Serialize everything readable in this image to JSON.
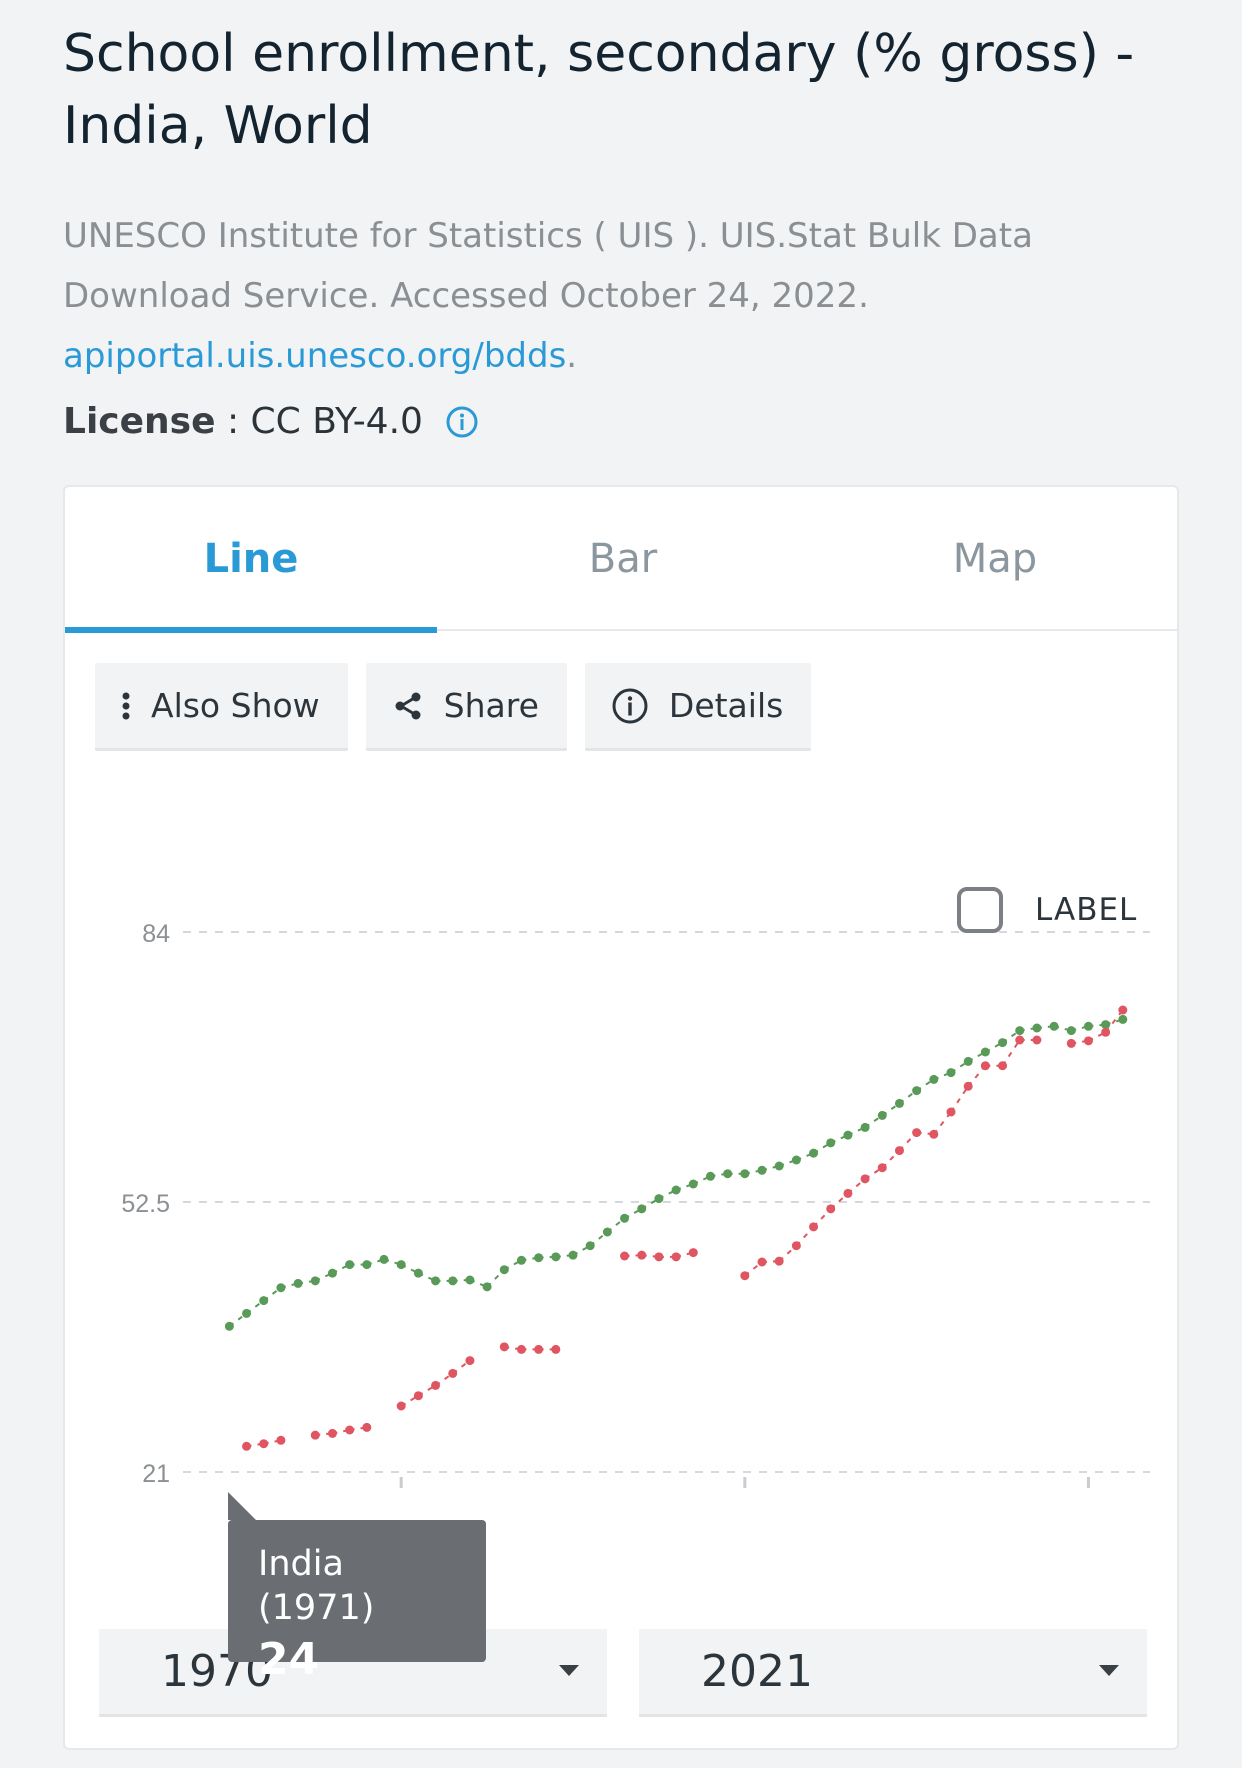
{
  "header": {
    "title": "School enrollment, secondary (% gross) - India, World",
    "source_text": "UNESCO Institute for Statistics ( UIS ). UIS.Stat Bulk Data Download Service. Accessed October 24, 2022.",
    "source_link": "apiportal.uis.unesco.org/bdds",
    "source_link_suffix": ".",
    "license_label": "License",
    "license_sep": " : ",
    "license_value": "CC BY-4.0"
  },
  "tabs": [
    {
      "label": "Line",
      "active": true
    },
    {
      "label": "Bar",
      "active": false
    },
    {
      "label": "Map",
      "active": false
    }
  ],
  "toolbar": {
    "also_show": "Also Show",
    "share": "Share",
    "details": "Details"
  },
  "label_toggle": "LABEL",
  "tooltip": {
    "title": "India (1971)",
    "value": "24"
  },
  "range": {
    "start": "1970",
    "end": "2021"
  },
  "colors": {
    "accent": "#2a9ad7",
    "world": "#5a9a58",
    "india": "#e05562"
  },
  "chart_data": {
    "type": "line",
    "yticks": [
      21,
      52.5,
      84
    ],
    "ytick_labels": [
      "21",
      "52.5",
      "84"
    ],
    "ylim": [
      21,
      84
    ],
    "xlim": [
      1970,
      2021
    ],
    "xticks": [
      1980,
      2000,
      2020
    ],
    "grid": true,
    "series": [
      {
        "key": "world",
        "color": "#5a9a58",
        "points": [
          [
            1970,
            38
          ],
          [
            1971,
            39.5
          ],
          [
            1972,
            41
          ],
          [
            1973,
            42.5
          ],
          [
            1974,
            43
          ],
          [
            1975,
            43.3
          ],
          [
            1976,
            44.2
          ],
          [
            1977,
            45.2
          ],
          [
            1978,
            45.2
          ],
          [
            1979,
            45.8
          ],
          [
            1980,
            45.2
          ],
          [
            1981,
            44.2
          ],
          [
            1982,
            43.3
          ],
          [
            1983,
            43.3
          ],
          [
            1984,
            43.4
          ],
          [
            1985,
            42.6
          ],
          [
            1986,
            44.6
          ],
          [
            1987,
            45.7
          ],
          [
            1988,
            46
          ],
          [
            1989,
            46.1
          ],
          [
            1990,
            46.3
          ],
          [
            1991,
            47.4
          ],
          [
            1992,
            49
          ],
          [
            1993,
            50.6
          ],
          [
            1994,
            51.7
          ],
          [
            1995,
            52.9
          ],
          [
            1996,
            53.9
          ],
          [
            1997,
            54.6
          ],
          [
            1998,
            55.5
          ],
          [
            1999,
            55.8
          ],
          [
            2000,
            55.8
          ],
          [
            2001,
            56.2
          ],
          [
            2002,
            56.7
          ],
          [
            2003,
            57.4
          ],
          [
            2004,
            58.2
          ],
          [
            2005,
            59.4
          ],
          [
            2006,
            60.3
          ],
          [
            2007,
            61.2
          ],
          [
            2008,
            62.6
          ],
          [
            2009,
            64
          ],
          [
            2010,
            65.5
          ],
          [
            2011,
            66.8
          ],
          [
            2012,
            67.6
          ],
          [
            2013,
            68.9
          ],
          [
            2014,
            70
          ],
          [
            2015,
            71.1
          ],
          [
            2016,
            72.5
          ],
          [
            2017,
            72.8
          ],
          [
            2018,
            73
          ],
          [
            2019,
            72.5
          ],
          [
            2020,
            73
          ],
          [
            2021,
            73.2
          ],
          [
            2022,
            73.8
          ]
        ]
      },
      {
        "key": "india",
        "color": "#e05562",
        "points": [
          [
            1971,
            24
          ],
          [
            1972,
            24.3
          ],
          [
            1973,
            24.7
          ],
          [
            1975,
            25.3
          ],
          [
            1976,
            25.5
          ],
          [
            1977,
            25.9
          ],
          [
            1978,
            26.2
          ],
          [
            1980,
            28.7
          ],
          [
            1981,
            29.9
          ],
          [
            1982,
            31.1
          ],
          [
            1983,
            32.5
          ],
          [
            1984,
            34
          ],
          [
            1986,
            35.6
          ],
          [
            1987,
            35.3
          ],
          [
            1988,
            35.3
          ],
          [
            1989,
            35.3
          ],
          [
            1993,
            46.2
          ],
          [
            1994,
            46.3
          ],
          [
            1995,
            46.1
          ],
          [
            1996,
            46.1
          ],
          [
            1997,
            46.6
          ],
          [
            2000,
            43.9
          ],
          [
            2001,
            45.5
          ],
          [
            2002,
            45.6
          ],
          [
            2003,
            47.4
          ],
          [
            2004,
            49.6
          ],
          [
            2005,
            51.7
          ],
          [
            2006,
            53.5
          ],
          [
            2007,
            55.2
          ],
          [
            2008,
            56.5
          ],
          [
            2009,
            58.5
          ],
          [
            2010,
            60.6
          ],
          [
            2011,
            60.4
          ],
          [
            2012,
            63
          ],
          [
            2013,
            66
          ],
          [
            2014,
            68.4
          ],
          [
            2015,
            68.4
          ],
          [
            2016,
            71.4
          ],
          [
            2017,
            71.4
          ],
          [
            2019,
            71
          ],
          [
            2020,
            71.3
          ],
          [
            2021,
            72.3
          ],
          [
            2022,
            74.9
          ]
        ]
      }
    ]
  }
}
